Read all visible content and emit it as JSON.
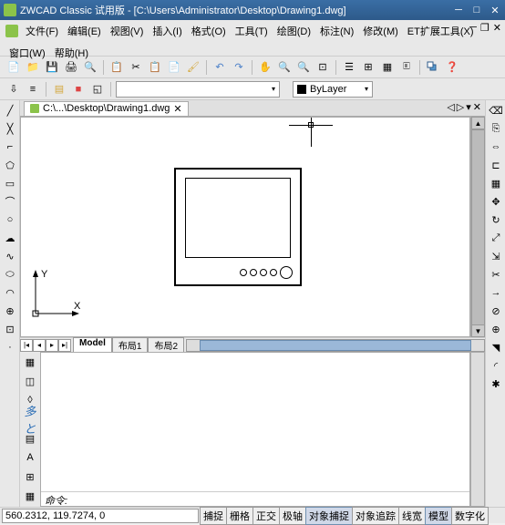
{
  "titlebar": {
    "app": "ZWCAD Classic 试用版",
    "path": "[C:\\Users\\Administrator\\Desktop\\Drawing1.dwg]"
  },
  "menu": {
    "file": "文件(F)",
    "edit": "编辑(E)",
    "view": "视图(V)",
    "insert": "插入(I)",
    "format": "格式(O)",
    "tools": "工具(T)",
    "draw": "绘图(D)",
    "dim": "标注(N)",
    "modify": "修改(M)",
    "et": "ET扩展工具(X)",
    "window": "窗口(W)",
    "help": "帮助(H)"
  },
  "layerbar": {
    "layer": "ByLayer"
  },
  "doctab": {
    "label": "C:\\...\\Desktop\\Drawing1.dwg"
  },
  "ucs": {
    "x": "X",
    "y": "Y"
  },
  "modeltabs": {
    "model": "Model",
    "l1": "布局1",
    "l2": "布局2"
  },
  "cmd": {
    "prompt": "命令:"
  },
  "status": {
    "coords": "560.2312, 119.7274, 0",
    "snap": "捕捉",
    "grid": "栅格",
    "ortho": "正交",
    "polar": "极轴",
    "osnap": "对象捕捉",
    "otrack": "对象追踪",
    "lwt": "线宽",
    "model": "模型",
    "dyn": "数字化"
  }
}
